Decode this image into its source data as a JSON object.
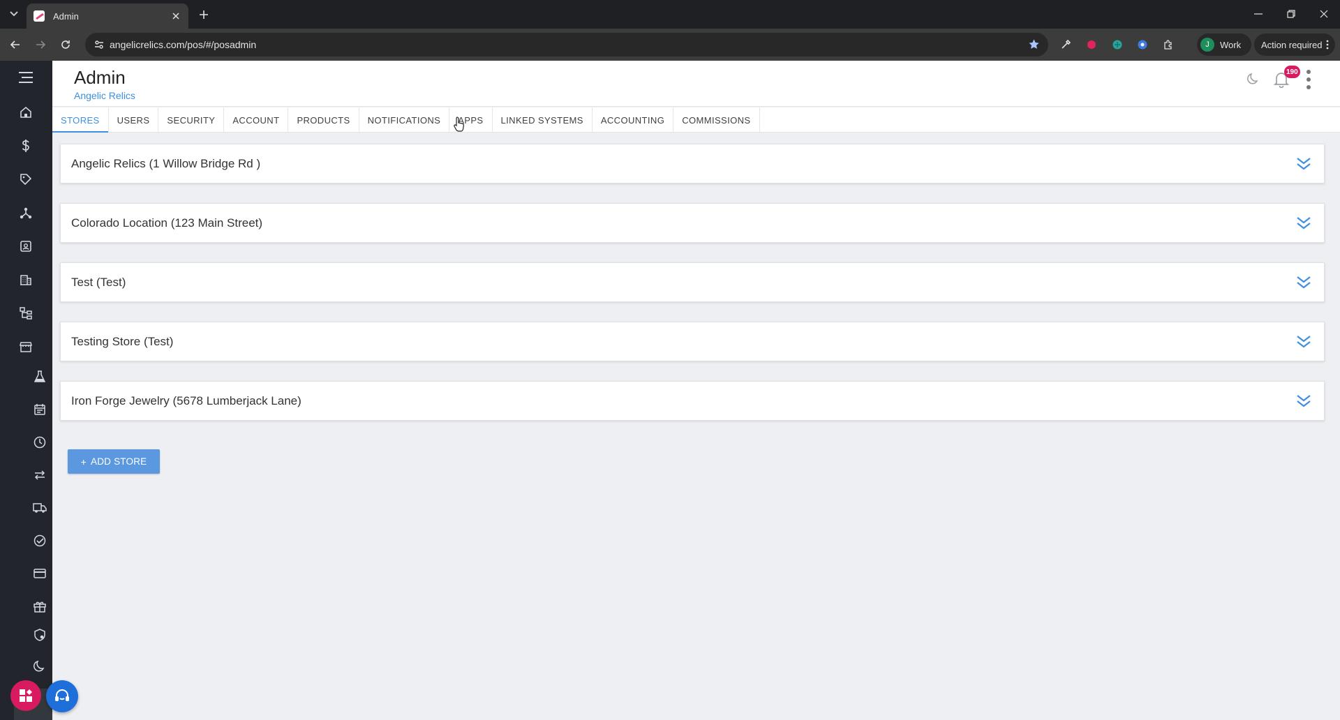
{
  "browser": {
    "tab_title": "Admin",
    "url": "angelicrelics.com/pos/#/posadmin",
    "profile_initial": "J",
    "profile_label": "Work",
    "action_required_label": "Action required"
  },
  "header": {
    "title": "Admin",
    "subtitle": "Angelic Relics",
    "notification_count": "190"
  },
  "tabs": [
    {
      "label": "STORES",
      "active": true
    },
    {
      "label": "USERS"
    },
    {
      "label": "SECURITY"
    },
    {
      "label": "ACCOUNT"
    },
    {
      "label": "PRODUCTS"
    },
    {
      "label": "NOTIFICATIONS"
    },
    {
      "label": "APPS"
    },
    {
      "label": "LINKED SYSTEMS"
    },
    {
      "label": "ACCOUNTING"
    },
    {
      "label": "COMMISSIONS"
    }
  ],
  "stores": [
    {
      "name": "Angelic Relics (1 Willow Bridge Rd )"
    },
    {
      "name": "Colorado Location (123 Main Street)"
    },
    {
      "name": "Test (Test)"
    },
    {
      "name": "Testing Store (Test)"
    },
    {
      "name": "Iron Forge Jewelry (5678 Lumberjack Lane)"
    }
  ],
  "add_store_label": "ADD STORE",
  "colors": {
    "accent": "#3d8fe0",
    "sidebar_bg": "#22252b",
    "badge": "#d81b60",
    "add_button": "#5b98e0"
  },
  "sidebar_icons": [
    "menu-icon",
    "home-icon",
    "dollar-icon",
    "tag-icon",
    "hierarchy-icon",
    "contact-card-icon",
    "building-icon",
    "category-tree-icon",
    "store-icon",
    "lab-flask-icon",
    "calendar-icon",
    "clock-icon",
    "transfer-icon",
    "truck-icon",
    "check-circle-icon",
    "credit-card-icon",
    "gift-icon",
    "admin-shield-icon",
    "moon-icon"
  ]
}
